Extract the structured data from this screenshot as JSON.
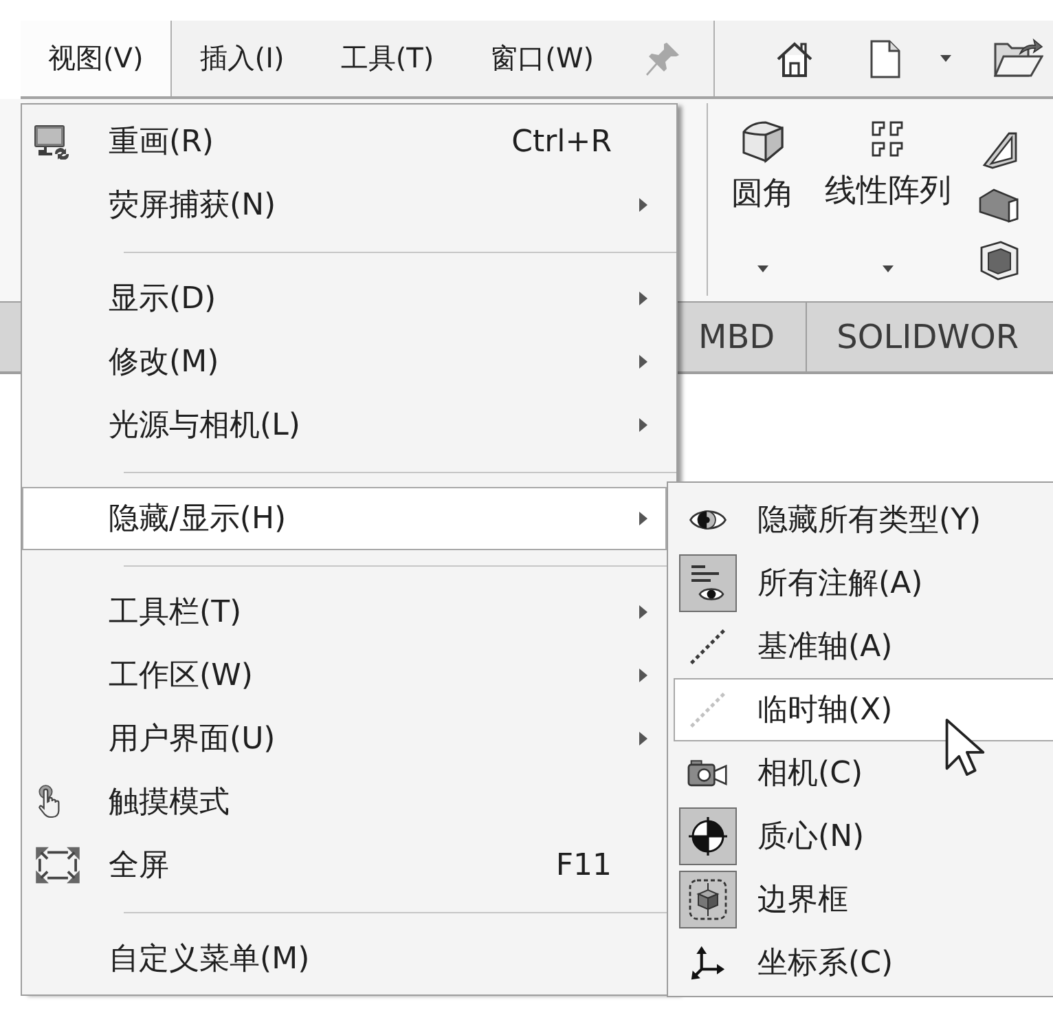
{
  "menubar": {
    "items": [
      {
        "label": "视图(V)",
        "selected": true
      },
      {
        "label": "插入(I)",
        "selected": false
      },
      {
        "label": "工具(T)",
        "selected": false
      },
      {
        "label": "窗口(W)",
        "selected": false
      }
    ]
  },
  "ribbon": {
    "buttons": [
      {
        "label": "圆角",
        "dropdown": true
      },
      {
        "label": "线性阵列",
        "dropdown": true
      }
    ]
  },
  "tabs": [
    {
      "label": "MBD"
    },
    {
      "label": "SOLIDWOR"
    }
  ],
  "menu": {
    "groups": [
      {
        "items": [
          {
            "label": "重画(R)",
            "shortcut": "Ctrl+R",
            "has_submenu": false,
            "selected": false
          },
          {
            "label": "荧屏捕获(N)",
            "has_submenu": true,
            "selected": false
          }
        ]
      },
      {
        "items": [
          {
            "label": "显示(D)",
            "has_submenu": true,
            "selected": false
          },
          {
            "label": "修改(M)",
            "has_submenu": true,
            "selected": false
          },
          {
            "label": "光源与相机(L)",
            "has_submenu": true,
            "selected": false
          }
        ]
      },
      {
        "items": [
          {
            "label": "隐藏/显示(H)",
            "has_submenu": true,
            "selected": true
          }
        ]
      },
      {
        "items": [
          {
            "label": "工具栏(T)",
            "has_submenu": true,
            "selected": false
          },
          {
            "label": "工作区(W)",
            "has_submenu": true,
            "selected": false
          },
          {
            "label": "用户界面(U)",
            "has_submenu": true,
            "selected": false
          },
          {
            "label": "触摸模式",
            "has_submenu": false,
            "selected": false
          },
          {
            "label": "全屏",
            "shortcut": "F11",
            "has_submenu": false,
            "selected": false
          }
        ]
      },
      {
        "items": [
          {
            "label": "自定义菜单(M)",
            "has_submenu": false,
            "selected": false
          }
        ]
      }
    ]
  },
  "submenu": {
    "items": [
      {
        "label": "隐藏所有类型(Y)",
        "checked": false,
        "selected": false
      },
      {
        "label": "所有注解(A)",
        "checked": true,
        "selected": false
      },
      {
        "label": "基准轴(A)",
        "checked": false,
        "selected": false
      },
      {
        "label": "临时轴(X)",
        "checked": false,
        "selected": true
      },
      {
        "label": "相机(C)",
        "checked": false,
        "selected": false
      },
      {
        "label": "质心(N)",
        "checked": true,
        "selected": false
      },
      {
        "label": "边界框",
        "checked": true,
        "selected": false
      },
      {
        "label": "坐标系(C)",
        "checked": false,
        "selected": false
      }
    ]
  }
}
